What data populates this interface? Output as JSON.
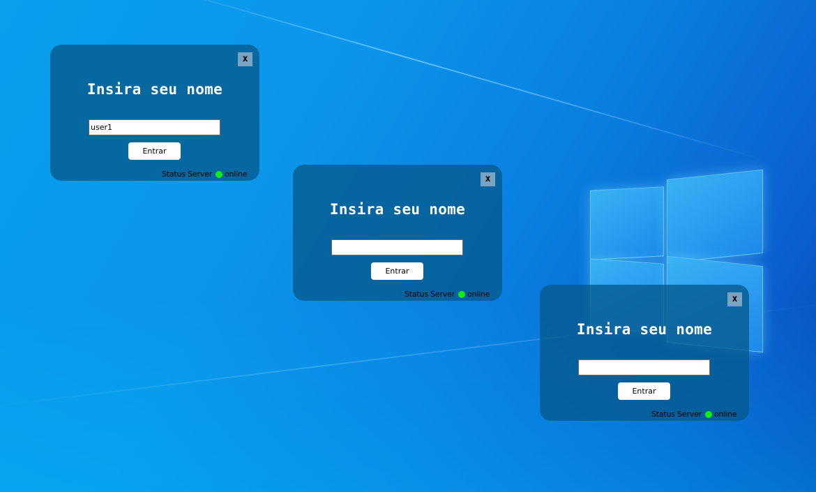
{
  "dialogs": [
    {
      "close_label": "x",
      "title": "Insira seu nome",
      "input_value": "user1",
      "input_placeholder": "",
      "button_label": "Entrar",
      "status_label": "Status Server",
      "status_value": "online"
    },
    {
      "close_label": "x",
      "title": "Insira seu nome",
      "input_value": "",
      "input_placeholder": "",
      "button_label": "Entrar",
      "status_label": "Status Server",
      "status_value": "online"
    },
    {
      "close_label": "x",
      "title": "Insira seu nome",
      "input_value": "",
      "input_placeholder": "",
      "button_label": "Entrar",
      "status_label": "Status Server",
      "status_value": "online"
    }
  ],
  "colors": {
    "status_online": "#10ee10",
    "dialog_background": "#055a8c",
    "close_button": "#7aa3c2",
    "wallpaper": "#0a8fe8"
  },
  "icons": {
    "status_indicator": "status-dot-icon",
    "wallpaper_logo": "windows-logo"
  }
}
